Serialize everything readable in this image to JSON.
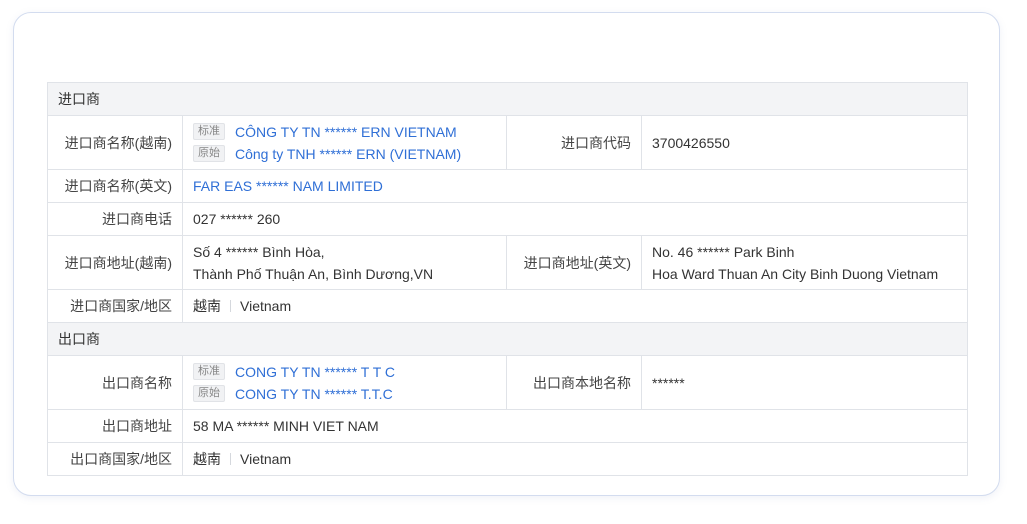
{
  "importer": {
    "section_title": "进口商",
    "name_vn_label": "进口商名称(越南)",
    "tag_standard": "标准",
    "tag_original": "原始",
    "name_vn_standard": "CÔNG TY TN  ****** ERN VIETNAM",
    "name_vn_original": "Công ty TNH  ******  ERN (VIETNAM)",
    "code_label": "进口商代码",
    "code_value": "3700426550",
    "name_en_label": "进口商名称(英文)",
    "name_en_value": "FAR EAS ****** NAM LIMITED",
    "phone_label": "进口商电话",
    "phone_value": "027 ****** 260",
    "address_vn_label": "进口商地址(越南)",
    "address_vn_line1": "Số 4  ******  Bình Hòa,",
    "address_vn_line2": "Thành Phố Thuận An, Bình Dương,VN",
    "address_en_label": "进口商地址(英文)",
    "address_en_line1": "No. 46  ****** Park Binh",
    "address_en_line2": "Hoa Ward Thuan An City Binh Duong Vietnam",
    "country_label": "进口商国家/地区",
    "country_zh": "越南",
    "country_en": "Vietnam"
  },
  "exporter": {
    "section_title": "出口商",
    "name_label": "出口商名称",
    "tag_standard": "标准",
    "tag_original": "原始",
    "name_standard": "CONG TY TN  ******  T T C",
    "name_original": "CONG TY TN  ******  T.T.C",
    "local_name_label": "出口商本地名称",
    "local_name_value": "******",
    "address_label": "出口商地址",
    "address_value": "58 MA  ******  MINH VIET NAM",
    "country_label": "出口商国家/地区",
    "country_zh": "越南",
    "country_en": "Vietnam"
  }
}
